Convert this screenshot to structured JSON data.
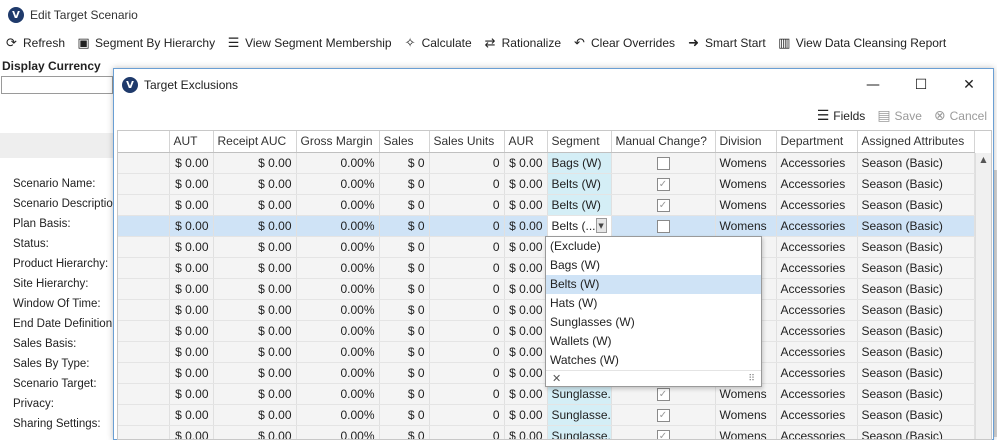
{
  "window": {
    "title": "Edit Target Scenario",
    "logo": "logo-icon"
  },
  "toolbar": [
    {
      "label": "Refresh",
      "icon": "refresh-icon",
      "glyph": "⟳"
    },
    {
      "label": "Segment By Hierarchy",
      "icon": "segment-hierarchy-icon",
      "glyph": "▣"
    },
    {
      "label": "View Segment Membership",
      "icon": "list-icon",
      "glyph": "☰"
    },
    {
      "label": "Calculate",
      "icon": "magic-wand-icon",
      "glyph": "✧"
    },
    {
      "label": "Rationalize",
      "icon": "exchange-icon",
      "glyph": "⇄"
    },
    {
      "label": "Clear Overrides",
      "icon": "undo-icon",
      "glyph": "↶"
    },
    {
      "label": "Smart Start",
      "icon": "arrow-right-icon",
      "glyph": "➜"
    },
    {
      "label": "View Data Cleansing Report",
      "icon": "report-icon",
      "glyph": "▥"
    }
  ],
  "display_currency": {
    "label": "Display Currency",
    "value": ""
  },
  "left_labels": [
    "Scenario Name:",
    "Scenario Description:",
    "Plan Basis:",
    "Status:",
    "Product Hierarchy:",
    "Site Hierarchy:",
    "Window Of Time:",
    "End Date Definition:",
    "Sales Basis:",
    "Sales By Type:",
    "Scenario Target:",
    "Privacy:",
    "Sharing Settings:"
  ],
  "modal": {
    "title": "Target Exclusions",
    "toolbar": {
      "fields": "Fields",
      "save": "Save",
      "cancel": "Cancel"
    },
    "columns": [
      "",
      "AUT",
      "Receipt AUC",
      "Gross Margin",
      "Sales",
      "Sales Units",
      "AUR",
      "Segment",
      "Manual Change?",
      "Division",
      "Department",
      "Assigned Attributes"
    ],
    "rows": [
      {
        "aut": "$ 0.00",
        "auc": "$ 0.00",
        "gm": "0.00%",
        "sales": "$ 0",
        "units": "0",
        "aur": "$ 0.00",
        "segment": "Bags (W)",
        "manual": false,
        "division": "Womens",
        "department": "Accessories",
        "attributes": "Season (Basic)"
      },
      {
        "aut": "$ 0.00",
        "auc": "$ 0.00",
        "gm": "0.00%",
        "sales": "$ 0",
        "units": "0",
        "aur": "$ 0.00",
        "segment": "Belts (W)",
        "manual": true,
        "division": "Womens",
        "department": "Accessories",
        "attributes": "Season (Basic)"
      },
      {
        "aut": "$ 0.00",
        "auc": "$ 0.00",
        "gm": "0.00%",
        "sales": "$ 0",
        "units": "0",
        "aur": "$ 0.00",
        "segment": "Belts (W)",
        "manual": true,
        "division": "Womens",
        "department": "Accessories",
        "attributes": "Season (Basic)"
      },
      {
        "aut": "$ 0.00",
        "auc": "$ 0.00",
        "gm": "0.00%",
        "sales": "$ 0",
        "units": "0",
        "aur": "$ 0.00",
        "segment": "Belts (...",
        "manual": false,
        "division": "Womens",
        "department": "Accessories",
        "attributes": "Season (Basic)"
      },
      {
        "aut": "$ 0.00",
        "auc": "$ 0.00",
        "gm": "0.00%",
        "sales": "$ 0",
        "units": "0",
        "aur": "$ 0.00",
        "segment": "",
        "manual": false,
        "division": "",
        "department": "Accessories",
        "attributes": "Season (Basic)"
      },
      {
        "aut": "$ 0.00",
        "auc": "$ 0.00",
        "gm": "0.00%",
        "sales": "$ 0",
        "units": "0",
        "aur": "$ 0.00",
        "segment": "",
        "manual": false,
        "division": "",
        "department": "Accessories",
        "attributes": "Season (Basic)"
      },
      {
        "aut": "$ 0.00",
        "auc": "$ 0.00",
        "gm": "0.00%",
        "sales": "$ 0",
        "units": "0",
        "aur": "$ 0.00",
        "segment": "",
        "manual": false,
        "division": "",
        "department": "Accessories",
        "attributes": "Season (Basic)"
      },
      {
        "aut": "$ 0.00",
        "auc": "$ 0.00",
        "gm": "0.00%",
        "sales": "$ 0",
        "units": "0",
        "aur": "$ 0.00",
        "segment": "",
        "manual": false,
        "division": "",
        "department": "Accessories",
        "attributes": "Season (Basic)"
      },
      {
        "aut": "$ 0.00",
        "auc": "$ 0.00",
        "gm": "0.00%",
        "sales": "$ 0",
        "units": "0",
        "aur": "$ 0.00",
        "segment": "",
        "manual": false,
        "division": "",
        "department": "Accessories",
        "attributes": "Season (Basic)"
      },
      {
        "aut": "$ 0.00",
        "auc": "$ 0.00",
        "gm": "0.00%",
        "sales": "$ 0",
        "units": "0",
        "aur": "$ 0.00",
        "segment": "",
        "manual": false,
        "division": "",
        "department": "Accessories",
        "attributes": "Season (Basic)"
      },
      {
        "aut": "$ 0.00",
        "auc": "$ 0.00",
        "gm": "0.00%",
        "sales": "$ 0",
        "units": "0",
        "aur": "$ 0.00",
        "segment": "",
        "manual": false,
        "division": "",
        "department": "Accessories",
        "attributes": "Season (Basic)"
      },
      {
        "aut": "$ 0.00",
        "auc": "$ 0.00",
        "gm": "0.00%",
        "sales": "$ 0",
        "units": "0",
        "aur": "$ 0.00",
        "segment": "Sunglasse...",
        "manual": true,
        "division": "Womens",
        "department": "Accessories",
        "attributes": "Season (Basic)"
      },
      {
        "aut": "$ 0.00",
        "auc": "$ 0.00",
        "gm": "0.00%",
        "sales": "$ 0",
        "units": "0",
        "aur": "$ 0.00",
        "segment": "Sunglasse...",
        "manual": true,
        "division": "Womens",
        "department": "Accessories",
        "attributes": "Season (Basic)"
      },
      {
        "aut": "$ 0.00",
        "auc": "$ 0.00",
        "gm": "0.00%",
        "sales": "$ 0",
        "units": "0",
        "aur": "$ 0.00",
        "segment": "Sunglasse...",
        "manual": true,
        "division": "Womens",
        "department": "Accessories",
        "attributes": "Season (Basic)"
      }
    ],
    "selected_row": 3,
    "segment_dropdown": {
      "options": [
        "(Exclude)",
        "Bags (W)",
        "Belts (W)",
        "Hats (W)",
        "Sunglasses (W)",
        "Wallets (W)",
        "Watches (W)"
      ],
      "selected": "Belts (W)"
    }
  }
}
